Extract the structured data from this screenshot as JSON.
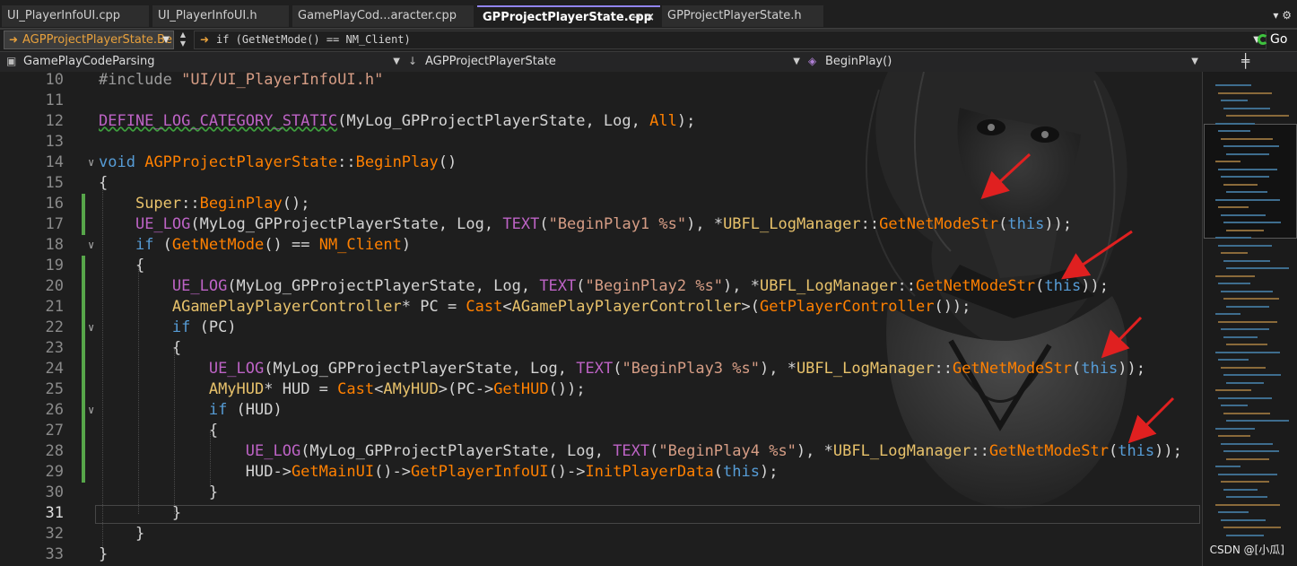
{
  "tabs": [
    {
      "label": "UI_PlayerInfoUI.cpp"
    },
    {
      "label": "UI_PlayerInfoUI.h"
    },
    {
      "label": "GamePlayCod...aracter.cpp"
    },
    {
      "label": "GPProjectPlayerState.cpp",
      "active": true
    },
    {
      "label": "GPProjectPlayerState.h"
    }
  ],
  "tab_pin": "⊣",
  "tab_close": "×",
  "findbar": {
    "scope": "AGPProjectPlayerState.Be",
    "condition": "if (GetNetMode() == NM_Client)",
    "go_label": "Go"
  },
  "nav": {
    "project": "GamePlayCodeParsing",
    "class": "AGPProjectPlayerState",
    "member": "BeginPlay()"
  },
  "editor": {
    "current_line": 31,
    "lines": [
      {
        "n": "10",
        "html": "<span class=\"pp\">#include</span> <span class=\"st\">\"UI/UI_PlayerInfoUI.h\"</span>"
      },
      {
        "n": "11",
        "html": ""
      },
      {
        "n": "12",
        "html": "<span class=\"mcu\">DEFINE_LOG_CATEGORY_STATIC</span>(MyLog_GPProjectPlayerState, Log, <span class=\"vm\">All</span>);"
      },
      {
        "n": "13",
        "html": ""
      },
      {
        "n": "14",
        "html": "<span class=\"kw\">void</span> <span class=\"ty2\">AGPProjectPlayerState</span>::<span class=\"vm\">BeginPlay</span>()"
      },
      {
        "n": "15",
        "html": "{"
      },
      {
        "n": "16",
        "html": "    <span class=\"yl\">Super</span>::<span class=\"vm\">BeginPlay</span>();"
      },
      {
        "n": "17",
        "html": "    <span class=\"mc\">UE_LOG</span>(MyLog_GPProjectPlayerState, Log, <span class=\"mc\">TEXT</span>(<span class=\"st\">\"BeginPlay1 %s\"</span>), *<span class=\"yl\">UBFL_LogManager</span>::<span class=\"vm\">GetNetModeStr</span>(<span class=\"kw\">this</span>));"
      },
      {
        "n": "18",
        "html": "    <span class=\"kw\">if</span> (<span class=\"vm\">GetNetMode</span>() == <span class=\"vm\">NM_Client</span>)"
      },
      {
        "n": "19",
        "html": "    {"
      },
      {
        "n": "20",
        "html": "        <span class=\"mc\">UE_LOG</span>(MyLog_GPProjectPlayerState, Log, <span class=\"mc\">TEXT</span>(<span class=\"st\">\"BeginPlay2 %s\"</span>), *<span class=\"yl\">UBFL_LogManager</span>::<span class=\"vm\">GetNetModeStr</span>(<span class=\"kw\">this</span>));"
      },
      {
        "n": "21",
        "html": "        <span class=\"yl\">AGamePlayPlayerController</span>* PC = <span class=\"vm\">Cast</span>&lt;<span class=\"yl\">AGamePlayPlayerController</span>&gt;(<span class=\"vm\">GetPlayerController</span>());"
      },
      {
        "n": "22",
        "html": "        <span class=\"kw\">if</span> (PC)"
      },
      {
        "n": "23",
        "html": "        {"
      },
      {
        "n": "24",
        "html": "            <span class=\"mc\">UE_LOG</span>(MyLog_GPProjectPlayerState, Log, <span class=\"mc\">TEXT</span>(<span class=\"st\">\"BeginPlay3 %s\"</span>), *<span class=\"yl\">UBFL_LogManager</span>::<span class=\"vm\">GetNetModeStr</span>(<span class=\"kw\">this</span>));"
      },
      {
        "n": "25",
        "html": "            <span class=\"yl\">AMyHUD</span>* HUD = <span class=\"vm\">Cast</span>&lt;<span class=\"yl\">AMyHUD</span>&gt;(PC-&gt;<span class=\"vm\">GetHUD</span>());"
      },
      {
        "n": "26",
        "html": "            <span class=\"kw\">if</span> (HUD)"
      },
      {
        "n": "27",
        "html": "            {"
      },
      {
        "n": "28",
        "html": "                <span class=\"mc\">UE_LOG</span>(MyLog_GPProjectPlayerState, Log, <span class=\"mc\">TEXT</span>(<span class=\"st\">\"BeginPlay4 %s\"</span>), *<span class=\"yl\">UBFL_LogManager</span>::<span class=\"vm\">GetNetModeStr</span>(<span class=\"kw\">this</span>));"
      },
      {
        "n": "29",
        "html": "                HUD-&gt;<span class=\"vm\">GetMainUI</span>()-&gt;<span class=\"vm\">GetPlayerInfoUI</span>()-&gt;<span class=\"vm\">InitPlayerData</span>(<span class=\"kw\">this</span>);"
      },
      {
        "n": "30",
        "html": "            }"
      },
      {
        "n": "31",
        "html": "        }"
      },
      {
        "n": "32",
        "html": "    }"
      },
      {
        "n": "33",
        "html": "}"
      }
    ]
  },
  "watermark": "CSDN @[小瓜]",
  "colors": {
    "accent_tab": "#9184ee",
    "change_bar": "#57a64a",
    "annotation_arrow": "#e02020"
  }
}
